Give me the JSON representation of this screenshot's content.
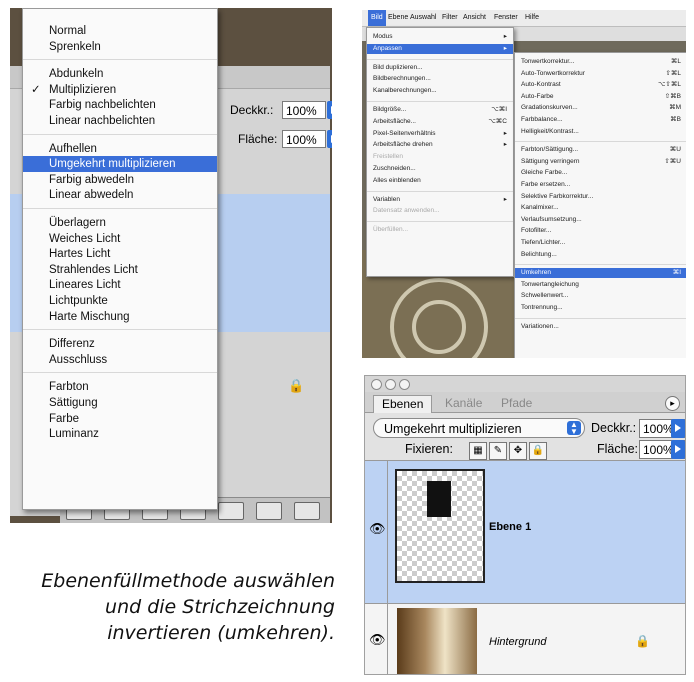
{
  "panel1": {
    "blend_menu": {
      "groups": [
        [
          "Normal",
          "Sprenkeln"
        ],
        [
          "Abdunkeln",
          "Multiplizieren",
          "Farbig nachbelichten",
          "Linear nachbelichten"
        ],
        [
          "Aufhellen",
          "Umgekehrt multiplizieren",
          "Farbig abwedeln",
          "Linear abwedeln"
        ],
        [
          "Überlagern",
          "Weiches Licht",
          "Hartes Licht",
          "Strahlendes Licht",
          "Lineares Licht",
          "Lichtpunkte",
          "Harte Mischung"
        ],
        [
          "Differenz",
          "Ausschluss"
        ],
        [
          "Farbton",
          "Sättigung",
          "Farbe",
          "Luminanz"
        ]
      ],
      "checked_item": "Multiplizieren",
      "highlighted_item": "Umgekehrt multiplizieren",
      "check_mark": "✓"
    },
    "opacity_label": "Deckkr.:",
    "opacity_value": "100%",
    "fill_label": "Fläche:",
    "fill_value": "100%",
    "lock_icon": "lock-icon"
  },
  "panel2": {
    "menubar": [
      "Bild",
      "Ebene",
      "Auswahl",
      "Filter",
      "Ansicht",
      "Fenster",
      "Hilfe"
    ],
    "active_menu": "Bild",
    "bild_menu": [
      {
        "label": "Modus",
        "shortcut": "▸"
      },
      {
        "label": "Anpassen",
        "shortcut": "▸",
        "hl": true
      },
      {
        "sep": true
      },
      {
        "label": "Bild duplizieren..."
      },
      {
        "label": "Bildberechnungen..."
      },
      {
        "label": "Kanalberechnungen..."
      },
      {
        "sep": true
      },
      {
        "label": "Bildgröße...",
        "shortcut": "⌥⌘I"
      },
      {
        "label": "Arbeitsfläche...",
        "shortcut": "⌥⌘C"
      },
      {
        "label": "Pixel-Seitenverhältnis",
        "shortcut": "▸"
      },
      {
        "label": "Arbeitsfläche drehen",
        "shortcut": "▸"
      },
      {
        "label": "Freistellen",
        "dis": true
      },
      {
        "label": "Zuschneiden..."
      },
      {
        "label": "Alles einblenden"
      },
      {
        "sep": true
      },
      {
        "label": "Variablen",
        "shortcut": "▸"
      },
      {
        "label": "Datensatz anwenden...",
        "dis": true
      },
      {
        "sep": true
      },
      {
        "label": "Überfüllen...",
        "dis": true
      }
    ],
    "anpassen_menu": [
      {
        "label": "Tonwertkorrektur...",
        "shortcut": "⌘L"
      },
      {
        "label": "Auto-Tonwertkorrektur",
        "shortcut": "⇧⌘L"
      },
      {
        "label": "Auto-Kontrast",
        "shortcut": "⌥⇧⌘L"
      },
      {
        "label": "Auto-Farbe",
        "shortcut": "⇧⌘B"
      },
      {
        "label": "Gradationskurven...",
        "shortcut": "⌘M"
      },
      {
        "label": "Farbbalance...",
        "shortcut": "⌘B"
      },
      {
        "label": "Helligkeit/Kontrast..."
      },
      {
        "sep": true
      },
      {
        "label": "Farbton/Sättigung...",
        "shortcut": "⌘U"
      },
      {
        "label": "Sättigung verringern",
        "shortcut": "⇧⌘U"
      },
      {
        "label": "Gleiche Farbe..."
      },
      {
        "label": "Farbe ersetzen..."
      },
      {
        "label": "Selektive Farbkorrektur..."
      },
      {
        "label": "Kanalmixer..."
      },
      {
        "label": "Verlaufsumsetzung..."
      },
      {
        "label": "Fotofilter..."
      },
      {
        "label": "Tiefen/Lichter..."
      },
      {
        "label": "Belichtung..."
      },
      {
        "sep": true
      },
      {
        "label": "Umkehren",
        "shortcut": "⌘I",
        "hl": true
      },
      {
        "label": "Tonwertangleichung"
      },
      {
        "label": "Schwellenwert..."
      },
      {
        "label": "Tontrennung..."
      },
      {
        "sep": true
      },
      {
        "label": "Variationen..."
      }
    ]
  },
  "panel3": {
    "tabs": [
      "Ebenen",
      "Kanäle",
      "Pfade"
    ],
    "active_tab": "Ebenen",
    "blend_mode": "Umgekehrt multiplizieren",
    "opacity_label": "Deckkr.:",
    "opacity_value": "100%",
    "lock_label": "Fixieren:",
    "fill_label": "Fläche:",
    "fill_value": "100%",
    "options_icon": "▸",
    "eye_icon": "👁",
    "lock_glyph": "🔒",
    "layers": [
      {
        "name": "Ebene 1",
        "selected": true
      },
      {
        "name": "Hintergrund",
        "selected": false,
        "locked": true
      }
    ]
  },
  "caption": {
    "lines": [
      "Ebenenfüllmethode auswählen",
      "und die Strichzeichnung",
      "invertieren (umkehren)."
    ]
  },
  "colors": {
    "menu_highlight": "#3a6ed8",
    "layer_selected": "#bcd2f3"
  }
}
